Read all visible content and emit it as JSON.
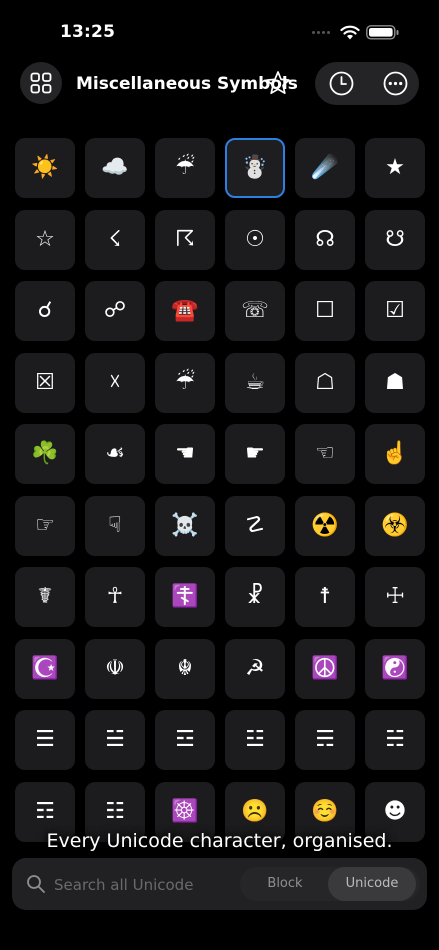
{
  "status": {
    "time": "13:25"
  },
  "header": {
    "title": "Miscellaneous Symbols"
  },
  "grid": [
    [
      "☀️",
      "☁️",
      "☔",
      "☃️",
      "☄️",
      "★"
    ],
    [
      "☆",
      "☇",
      "☈",
      "☉",
      "☊",
      "☋"
    ],
    [
      "☌",
      "☍",
      "☎️",
      "☏",
      "☐",
      "☑"
    ],
    [
      "☒",
      "☓",
      "☔",
      "☕",
      "☖",
      "☗"
    ],
    [
      "☘️",
      "☙",
      "☚",
      "☛",
      "☜",
      "☝️"
    ],
    [
      "☞",
      "☟",
      "☠️",
      "☡",
      "☢️",
      "☣️"
    ],
    [
      "☤",
      "☥",
      "☦️",
      "☧",
      "☨",
      "☩"
    ],
    [
      "☪️",
      "☫",
      "☬",
      "☭",
      "☮️",
      "☯️"
    ],
    [
      "☰",
      "☱",
      "☲",
      "☳",
      "☴",
      "☵"
    ],
    [
      "☶",
      "☷",
      "☸️",
      "☹️",
      "☺️",
      "☻"
    ]
  ],
  "selected": "☃️",
  "tagline": "Every Unicode character, organised.",
  "search": {
    "placeholder": "Search all Unicode",
    "segments": [
      "Block",
      "Unicode"
    ]
  }
}
